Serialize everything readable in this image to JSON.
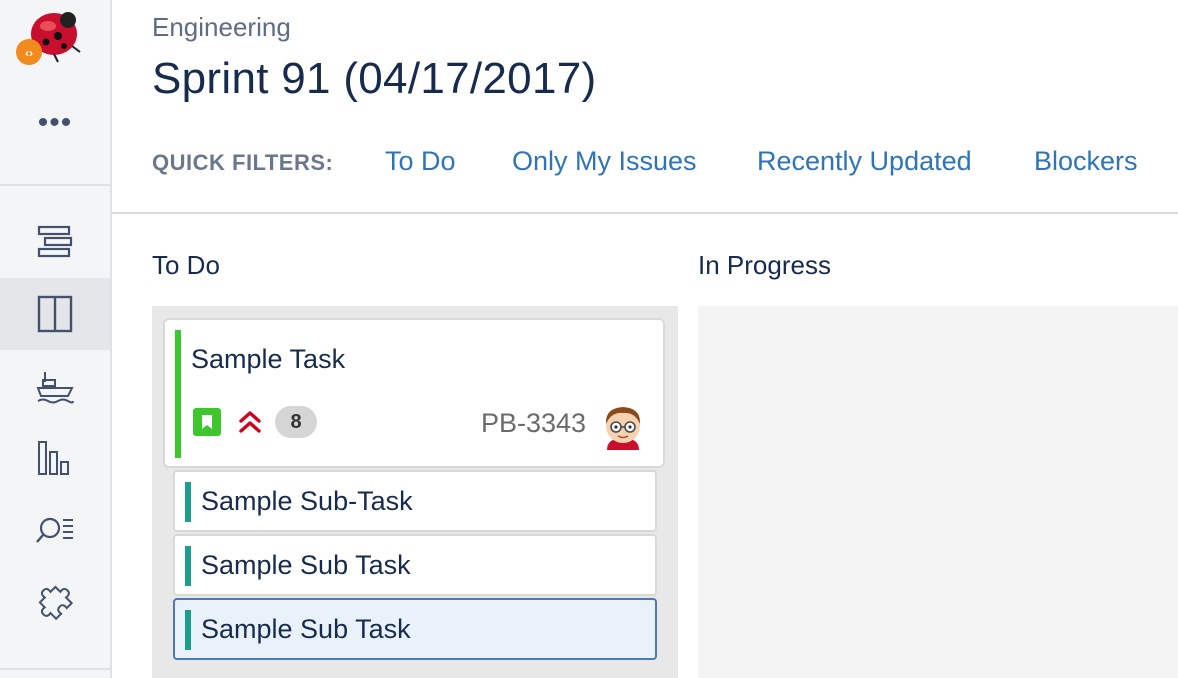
{
  "sidebar": {
    "more_label": "•••",
    "items": [
      {
        "name": "backlog",
        "icon": "backlog-icon"
      },
      {
        "name": "active-sprints",
        "icon": "board-icon",
        "active": true
      },
      {
        "name": "releases",
        "icon": "ship-icon"
      },
      {
        "name": "reports",
        "icon": "reports-icon"
      },
      {
        "name": "issues",
        "icon": "search-issues-icon"
      },
      {
        "name": "add-ons",
        "icon": "puzzle-icon"
      }
    ]
  },
  "header": {
    "project": "Engineering",
    "sprint_title": "Sprint 91 (04/17/2017)",
    "quick_filters_label": "QUICK FILTERS:",
    "quick_filters": [
      "To Do",
      "Only My Issues",
      "Recently Updated",
      "Blockers"
    ]
  },
  "columns": [
    {
      "title": "To Do"
    },
    {
      "title": "In Progress"
    }
  ],
  "card": {
    "summary": "Sample Task",
    "type_icon": "story-icon",
    "priority_icon": "highest-priority-icon",
    "estimate": "8",
    "key": "PB-3343",
    "assignee_icon": "avatar-icon"
  },
  "subtasks": [
    {
      "summary": "Sample Sub-Task"
    },
    {
      "summary": "Sample Sub Task"
    },
    {
      "summary": "Sample Sub Task",
      "selected": true
    }
  ],
  "colors": {
    "link": "#2f74b9",
    "story_green": "#3ec72d",
    "subtask_teal": "#1d9e8c",
    "priority_red": "#d0021b",
    "selected_bg": "#e9f2fb",
    "selected_border": "#4a79b5"
  }
}
